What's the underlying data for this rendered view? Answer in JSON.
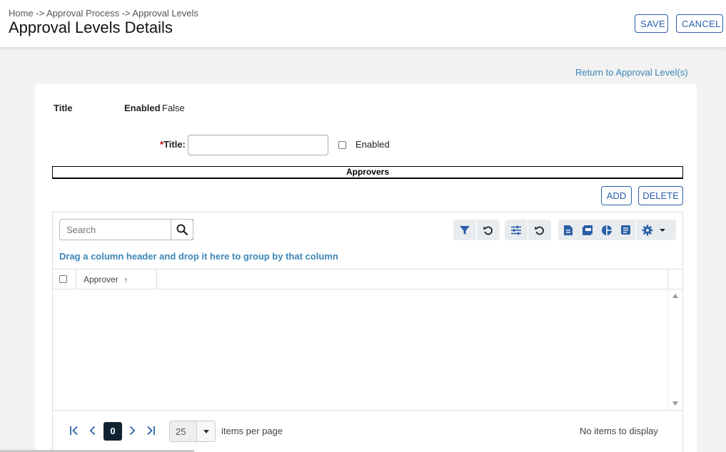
{
  "header": {
    "breadcrumb": "Home -> Approval Process -> Approval Levels",
    "title": "Approval Levels Details",
    "save_label": "SAVE",
    "cancel_label": "CANCEL"
  },
  "return_link": "Return to Approval Level(s)",
  "summary": {
    "title_label": "Title",
    "enabled_label": "Enabled",
    "enabled_value": "False"
  },
  "form": {
    "required_mark": "*",
    "title_label": "Title:",
    "title_value": "",
    "enabled_label": "Enabled"
  },
  "approvers": {
    "section_title": "Approvers",
    "add_label": "ADD",
    "delete_label": "DELETE",
    "search_placeholder": "Search",
    "group_hint": "Drag a column header and drop it here to group by that column",
    "columns": [
      "Approver"
    ],
    "sort_indicator": "↑",
    "rows": []
  },
  "pager": {
    "current_page": "0",
    "page_size": "25",
    "items_per_page_label": "items per page",
    "info": "No items to display"
  },
  "colors": {
    "accent": "#2a5fa8",
    "link": "#3a86b8",
    "pager_active": "#0f2430"
  }
}
